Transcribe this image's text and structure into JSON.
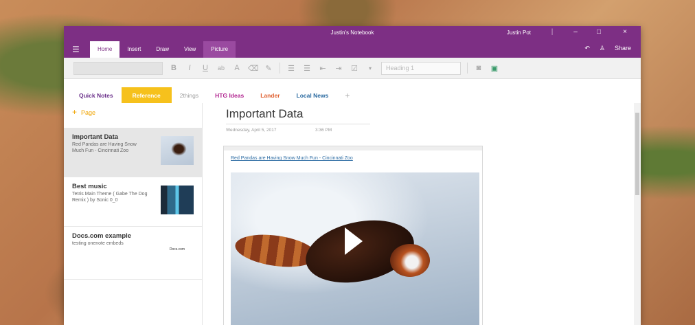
{
  "window": {
    "title": "Justin's Notebook",
    "user": "Justin Pot"
  },
  "window_controls": {
    "separator": "|",
    "minimize": "–",
    "maximize": "□",
    "close": "×"
  },
  "ribbon": {
    "menu_glyph": "☰",
    "tabs": [
      "Home",
      "Insert",
      "Draw",
      "View",
      "Picture"
    ],
    "right": {
      "undo": "↶",
      "person": "♙",
      "share": "Share"
    }
  },
  "toolbar": {
    "bold": "B",
    "italic": "I",
    "underline": "U",
    "highlight": "ab",
    "font_color": "A",
    "style_value": "Heading 1"
  },
  "sections": [
    "Quick Notes",
    "Reference",
    "2things",
    "HTG Ideas",
    "Lander",
    "Local News"
  ],
  "section_colors": [
    "#6a2f8a",
    "#f6c11c",
    "#a0a0a0",
    "#b0238f",
    "#e06030",
    "#2a6aa0"
  ],
  "add_section": "+",
  "pages_panel": {
    "add_page": "Page",
    "pages": [
      {
        "title": "Important Data",
        "snippet": "Red Pandas are Having Snow Much Fun - Cincinnati Zoo"
      },
      {
        "title": "Best music",
        "snippet": "Tetris Main Theme ( Gabe The Dog Remix ) by Sonic 0_0"
      },
      {
        "title": "Docs.com example",
        "snippet": "testing onenote embeds",
        "thumb_text": "Docs.com"
      }
    ]
  },
  "note": {
    "title": "Important Data",
    "date": "Wednesday, April 5, 2017",
    "time": "3:36 PM",
    "link_text": "Red Pandas are Having Snow Much Fun - Cincinnati Zoo"
  }
}
